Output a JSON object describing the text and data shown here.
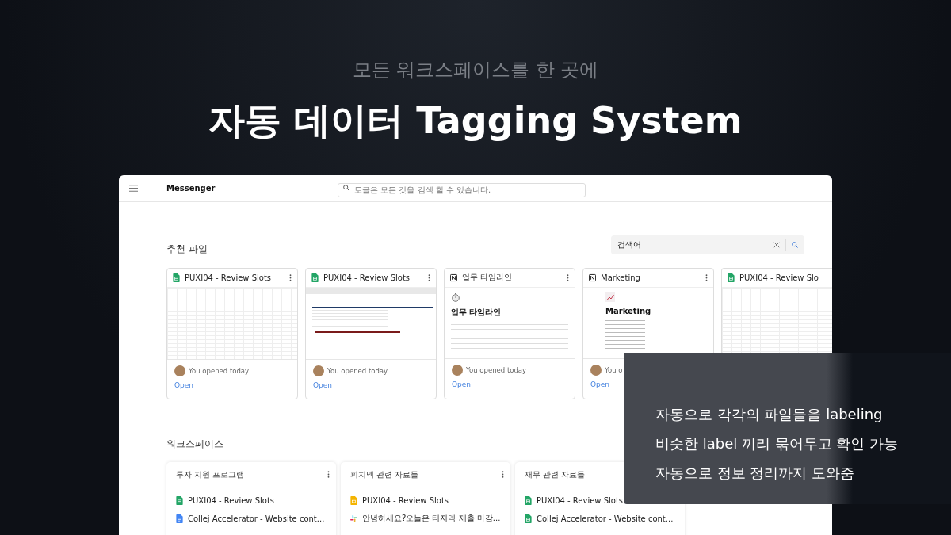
{
  "hero": {
    "subtitle": "모든 워크스페이스를 한 곳에",
    "title": "자동 데이터 Tagging System"
  },
  "window": {
    "title": "Messenger",
    "search": {
      "placeholder": "토글은 모든 것을 검색 할 수 있습니다."
    }
  },
  "recommended": {
    "heading": "추천 파일",
    "search": {
      "value": "검색어"
    },
    "files": [
      {
        "kind": "sheets",
        "name": "PUXI04 - Review Slots",
        "menu": true,
        "preview": {
          "kind": "sheet-grid"
        },
        "opened": "You opened today",
        "link": "Open"
      },
      {
        "kind": "sheets",
        "name": "PUXI04 - Review Slots",
        "menu": true,
        "preview": {
          "kind": "sheet-chart"
        },
        "opened": "You opened today",
        "link": "Open"
      },
      {
        "kind": "notion",
        "name": "업무 타임라인",
        "menu": true,
        "preview": {
          "kind": "notion-timeline",
          "title": "업무 타임라인"
        },
        "opened": "You opened today",
        "link": "Open"
      },
      {
        "kind": "notion",
        "name": "Marketing",
        "menu": true,
        "preview": {
          "kind": "notion-list",
          "title": "Marketing"
        },
        "opened": "You o",
        "link": "Open"
      },
      {
        "kind": "sheets",
        "name": "PUXI04 - Review Slo",
        "menu": false,
        "preview": {
          "kind": "sheet-grid"
        }
      }
    ]
  },
  "workspaces": {
    "heading": "워크스페이스",
    "items": [
      {
        "name": "투자 지원 프로그램",
        "menu": true,
        "files": [
          {
            "kind": "sheets",
            "name": "PUXI04 - Review Slots"
          },
          {
            "kind": "docs",
            "name": "Collej Accelerator - Website cont..."
          }
        ]
      },
      {
        "name": "피치덱 관련 자료들",
        "menu": true,
        "files": [
          {
            "kind": "slides",
            "name": "PUXI04 - Review Slots"
          },
          {
            "kind": "slack",
            "name": "안녕하세요?오늘은 티저덱 제출 마감..."
          }
        ]
      },
      {
        "name": "재무 관련 자료들",
        "menu": false,
        "files": [
          {
            "kind": "sheets",
            "name": "PUXI04 - Review Slots"
          },
          {
            "kind": "sheets",
            "name": "Collej Accelerator - Website cont..."
          }
        ]
      }
    ]
  },
  "features": [
    "자동으로 각각의 파일들을 labeling",
    "비슷한 label 끼리 묶어두고 확인 가능",
    "자동으로 정보 정리까지 도와줌"
  ]
}
